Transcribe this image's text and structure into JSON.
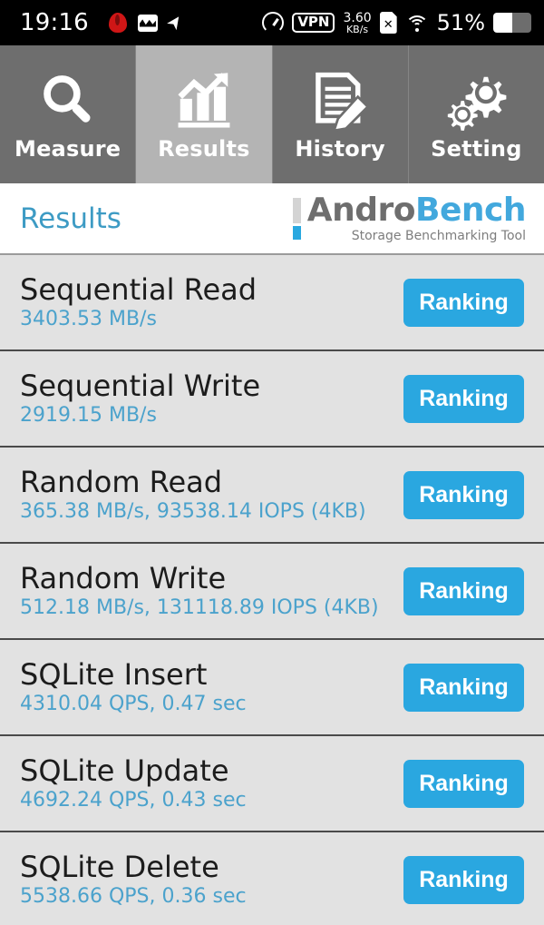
{
  "statusbar": {
    "time": "19:16",
    "left_icons": [
      "flame-icon",
      "image-icon",
      "cursor-icon"
    ],
    "network_speed_value": "3.60",
    "network_speed_unit": "KB/s",
    "vpn_label": "VPN",
    "battery_percent": "51%",
    "battery_level": 51,
    "right_icons": [
      "speedometer-icon",
      "vpn-icon",
      "sim-card-off-icon",
      "wifi-icon",
      "battery-icon"
    ]
  },
  "tabs": [
    {
      "label": "Measure",
      "icon": "magnifier-icon",
      "active": false
    },
    {
      "label": "Results",
      "icon": "bar-chart-arrow-icon",
      "active": true
    },
    {
      "label": "History",
      "icon": "document-pencil-icon",
      "active": false
    },
    {
      "label": "Setting",
      "icon": "gears-icon",
      "active": false
    }
  ],
  "header": {
    "page_title": "Results",
    "logo_first": "Andro",
    "logo_second": "Bench",
    "logo_subtitle": "Storage Benchmarking Tool"
  },
  "colors": {
    "accent_blue": "#2aa7e0",
    "value_blue": "#4ba2cc",
    "title_blue": "#3d9bc4",
    "tab_inactive": "#6e6e6e",
    "tab_active": "#b4b4b4",
    "row_bg": "#e2e2e2"
  },
  "results": [
    {
      "title": "Sequential Read",
      "value": "3403.53 MB/s",
      "button": "Ranking"
    },
    {
      "title": "Sequential Write",
      "value": "2919.15 MB/s",
      "button": "Ranking"
    },
    {
      "title": "Random Read",
      "value": "365.38 MB/s, 93538.14 IOPS (4KB)",
      "button": "Ranking"
    },
    {
      "title": "Random Write",
      "value": "512.18 MB/s, 131118.89 IOPS (4KB)",
      "button": "Ranking"
    },
    {
      "title": "SQLite Insert",
      "value": "4310.04 QPS, 0.47 sec",
      "button": "Ranking"
    },
    {
      "title": "SQLite Update",
      "value": "4692.24 QPS, 0.43 sec",
      "button": "Ranking"
    },
    {
      "title": "SQLite Delete",
      "value": "5538.66 QPS, 0.36 sec",
      "button": "Ranking"
    }
  ]
}
